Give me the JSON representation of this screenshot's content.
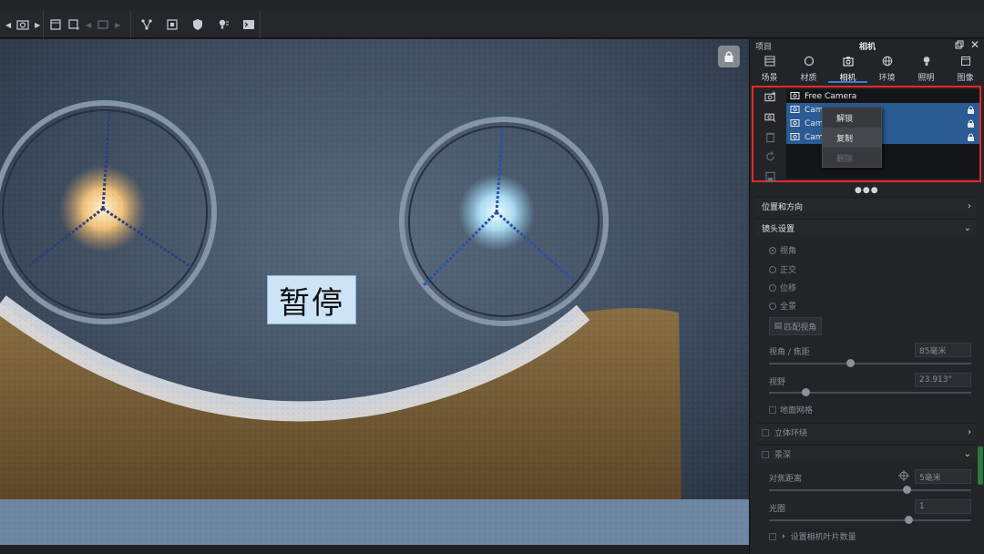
{
  "toolbar": {
    "icons": [
      "camera-nav-icon",
      "new-scene-icon",
      "add-scene-icon",
      "scene-prev-icon",
      "material-graph-icon",
      "render-icon",
      "shield-icon",
      "light-icon",
      "terminal-icon"
    ]
  },
  "viewport": {
    "overlay_text": "暂停"
  },
  "panel": {
    "left_label": "项目",
    "title": "相机",
    "tabs": [
      {
        "label": "场景",
        "icon": "scene-icon"
      },
      {
        "label": "材质",
        "icon": "material-icon"
      },
      {
        "label": "相机",
        "icon": "camera-icon",
        "active": true
      },
      {
        "label": "环境",
        "icon": "environment-icon"
      },
      {
        "label": "照明",
        "icon": "lighting-icon"
      },
      {
        "label": "图像",
        "icon": "image-icon"
      }
    ],
    "cameras": [
      {
        "name": "Free Camera",
        "selected": false,
        "locked": false
      },
      {
        "name": "Cam",
        "selected": true,
        "locked": true
      },
      {
        "name": "Cam",
        "selected": true,
        "locked": true
      },
      {
        "name": "Cam",
        "selected": true,
        "locked": true
      }
    ],
    "context_menu": [
      {
        "label": "解锁",
        "enabled": true
      },
      {
        "label": "复制",
        "enabled": true
      },
      {
        "label": "删除",
        "enabled": false
      }
    ],
    "sections": {
      "position": "位置和方向",
      "lens": "镜头设置",
      "stereo": "立体环绕",
      "dof": "景深"
    },
    "lens_options": [
      "视角",
      "正交",
      "位移",
      "全景"
    ],
    "match_button": "匹配视角",
    "fov_label": "视角 / 焦距",
    "fov_value": "85毫米",
    "fov_slider": 0.4,
    "view_label": "视野",
    "view_value": "23.913°",
    "view_slider": 0.18,
    "ground_grid": "地面网格",
    "focus_label": "对焦距离",
    "focus_value": "5毫米",
    "focus_slider": 0.68,
    "aperture_label": "光圈",
    "aperture_value": "1",
    "aperture_slider": 0.69,
    "blade_label": "设置相机叶片数量"
  },
  "colors": {
    "accent": "#3b7ad6",
    "selection": "#2a5b93",
    "highlight_border": "#e02a2a"
  }
}
